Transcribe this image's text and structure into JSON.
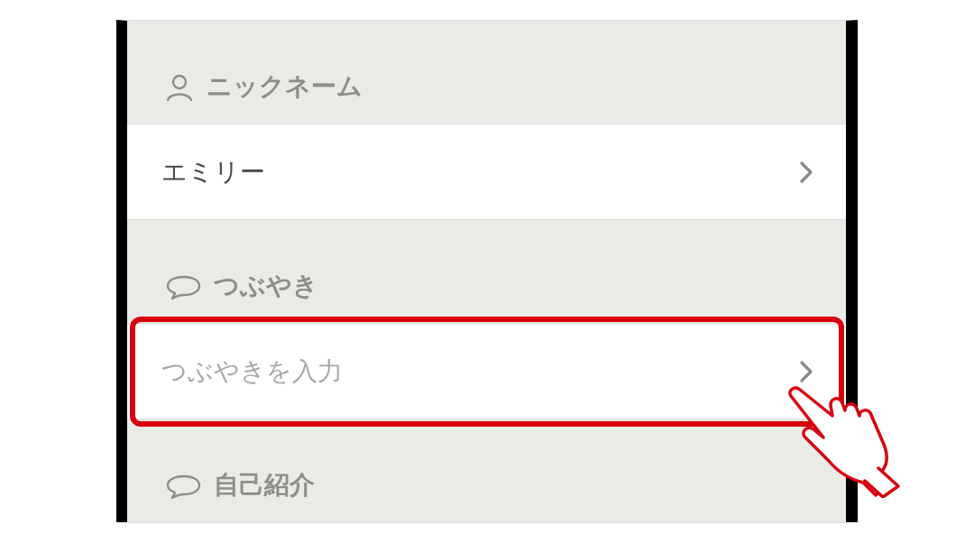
{
  "sections": [
    {
      "kind": "person",
      "title": "ニックネーム",
      "row": {
        "value": "エミリー"
      },
      "highlighted": false
    },
    {
      "kind": "bubble",
      "title": "つぶやき",
      "row": {
        "placeholder": "つぶやきを入力"
      },
      "highlighted": true
    },
    {
      "kind": "bubble",
      "title": "自己紹介"
    }
  ]
}
